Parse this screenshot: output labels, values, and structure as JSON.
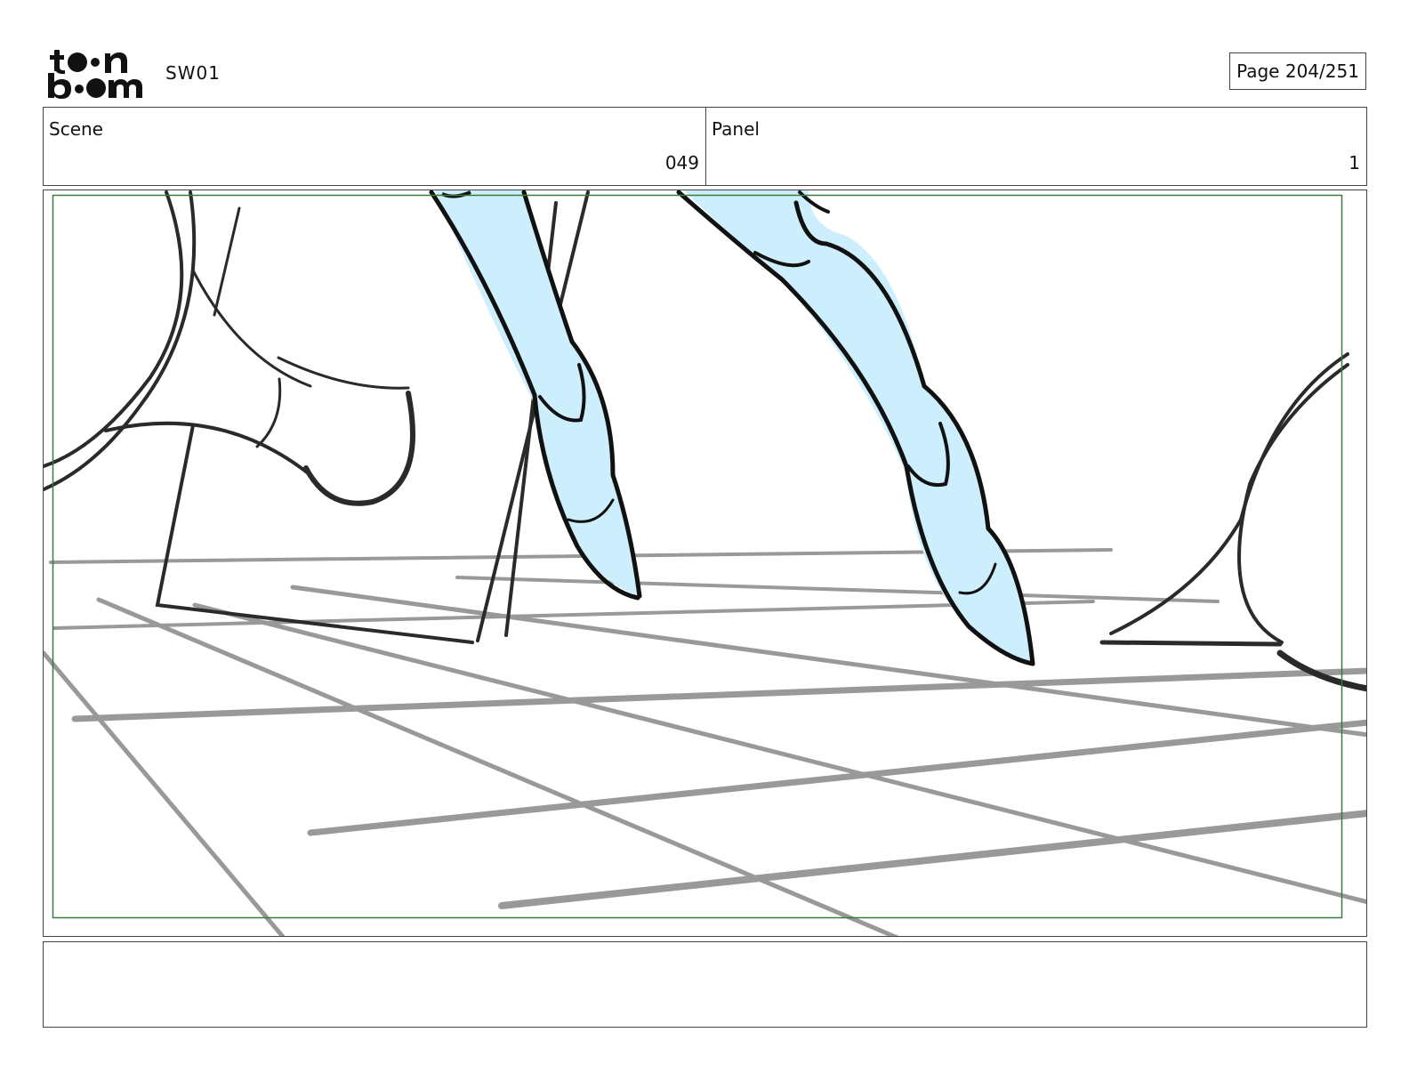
{
  "header": {
    "project": "SW01",
    "page_label": "Page 204/251"
  },
  "info": {
    "scene_label": "Scene",
    "scene_value": "049",
    "panel_label": "Panel",
    "panel_value": "1"
  },
  "colors": {
    "safe_frame": "#3a7a3a",
    "boot_fill": "#cdeefd",
    "ink": "#111111",
    "floor_lines": "#999999"
  }
}
